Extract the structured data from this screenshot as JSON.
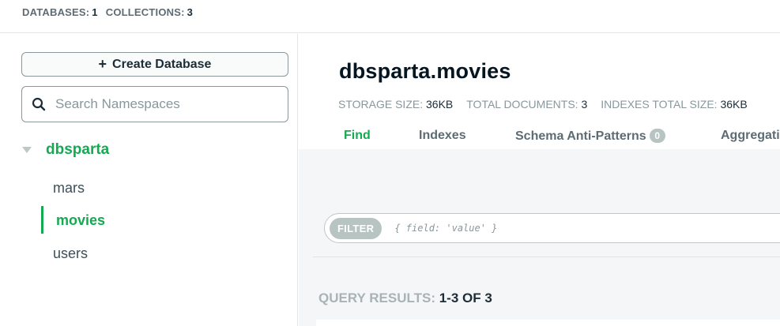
{
  "top": {
    "databases_label": "DATABASES:",
    "databases_value": "1",
    "collections_label": "COLLECTIONS:",
    "collections_value": "3"
  },
  "sidebar": {
    "create_database_label": "Create Database",
    "search_placeholder": "Search Namespaces",
    "database": "dbsparta",
    "collections": [
      "mars",
      "movies",
      "users"
    ],
    "active_collection": "movies"
  },
  "main": {
    "namespace_title": "dbsparta.movies",
    "stats": {
      "storage_label": "STORAGE SIZE:",
      "storage_value": "36KB",
      "docs_label": "TOTAL DOCUMENTS:",
      "docs_value": "3",
      "indexes_label": "INDEXES TOTAL SIZE:",
      "indexes_value": "36KB"
    },
    "tabs": [
      {
        "label": "Find",
        "active": true
      },
      {
        "label": "Indexes"
      },
      {
        "label": "Schema Anti-Patterns",
        "badge": "0"
      },
      {
        "label": "Aggregati"
      }
    ],
    "filter": {
      "pill": "FILTER",
      "placeholder": "{ field: 'value' }"
    },
    "results": {
      "label": "QUERY RESULTS:",
      "value": "1-3 OF 3"
    }
  },
  "colors": {
    "accent_green": "#13aa52",
    "text_dark": "#1c2d38",
    "muted": "#89979b"
  }
}
